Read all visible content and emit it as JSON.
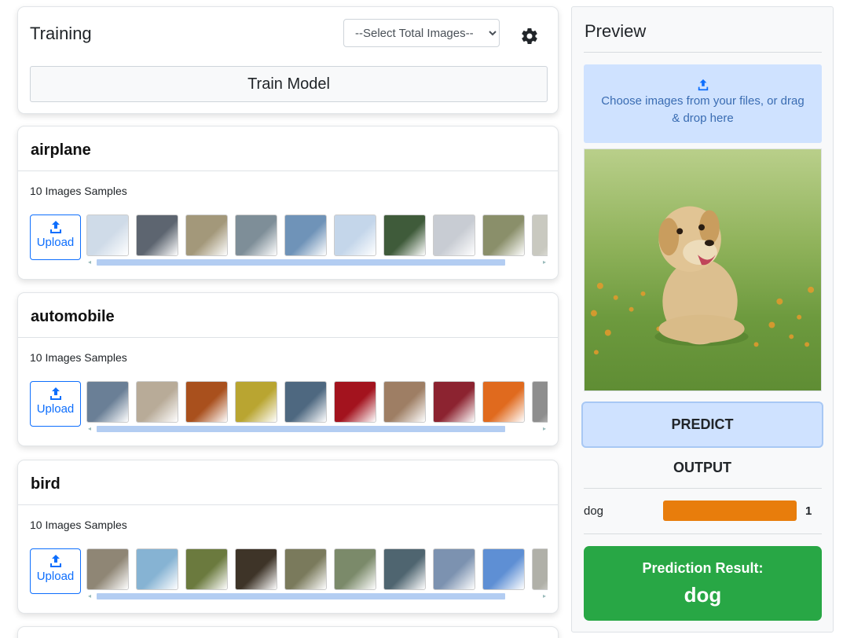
{
  "training": {
    "title": "Training",
    "select_placeholder": "--Select Total Images--",
    "train_button": "Train Model",
    "settings_icon": "gear-icon"
  },
  "classes": [
    {
      "name": "airplane",
      "samples_label": "10 Images Samples",
      "upload_label": "Upload",
      "thumbs": [
        "#cfdbe8",
        "#5d6570",
        "#a3987a",
        "#7e8e98",
        "#6f93b8",
        "#c4d6ea",
        "#3f5b3a",
        "#c8ccd3",
        "#8a8f6a",
        "#c9c9c0"
      ]
    },
    {
      "name": "automobile",
      "samples_label": "10 Images Samples",
      "upload_label": "Upload",
      "thumbs": [
        "#6a7f96",
        "#b8ab98",
        "#a9501d",
        "#b9a531",
        "#4e6880",
        "#a3131e",
        "#9e7e64",
        "#8c2330",
        "#e06a1e",
        "#8e8e8e"
      ]
    },
    {
      "name": "bird",
      "samples_label": "10 Images Samples",
      "upload_label": "Upload",
      "thumbs": [
        "#8f8675",
        "#86b3d3",
        "#6b7a3e",
        "#3e3428",
        "#7a7a5c",
        "#7b8a6a",
        "#4f6570",
        "#7c92b0",
        "#5e8fd4",
        "#b0b0a8"
      ]
    }
  ],
  "preview": {
    "title": "Preview",
    "dropzone_text": "Choose images from your files, or drag & drop here",
    "predict_button": "PREDICT",
    "output_label": "OUTPUT",
    "output_class": "dog",
    "output_value": "1",
    "result_label": "Prediction Result:",
    "result_value": "dog"
  },
  "colors": {
    "primary": "#0d6efd",
    "light_blue": "#cfe2ff",
    "output_bar": "#e87d0c",
    "success": "#28a745"
  }
}
